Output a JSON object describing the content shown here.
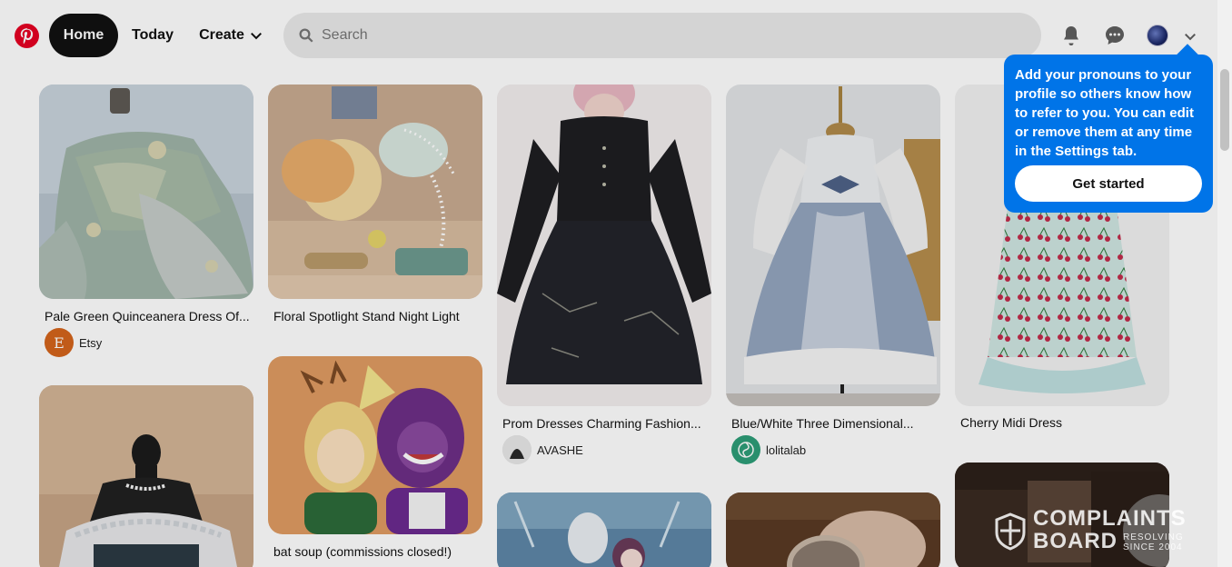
{
  "header": {
    "nav": {
      "home": "Home",
      "today": "Today",
      "create": "Create"
    },
    "search_placeholder": "Search"
  },
  "pins": [
    {
      "title": "Pale Green Quinceanera Dress Of...",
      "source": "Etsy",
      "source_initial": "E"
    },
    {
      "title": "Floral Spotlight Stand Night Light"
    },
    {
      "title": "bat soup (commissions closed!)"
    },
    {
      "title": "Prom Dresses Charming Fashion...",
      "source": "AVASHE"
    },
    {
      "title": "Blue/White Three Dimensional...",
      "source": "lolitalab"
    },
    {
      "title": "Cherry Midi Dress"
    }
  ],
  "tooltip": {
    "text": "Add your pronouns to your profile so others know how to refer to you. You can edit or remove them at any time in the Settings tab.",
    "button": "Get started"
  },
  "watermark": {
    "line1": "COMPLAINTS",
    "line2": "BOARD",
    "tagline1": "RESOLVING",
    "tagline2": "SINCE 2004"
  },
  "colors": {
    "brand": "#e60023",
    "tooltip": "#0074e8",
    "etsy": "#d5641c"
  }
}
